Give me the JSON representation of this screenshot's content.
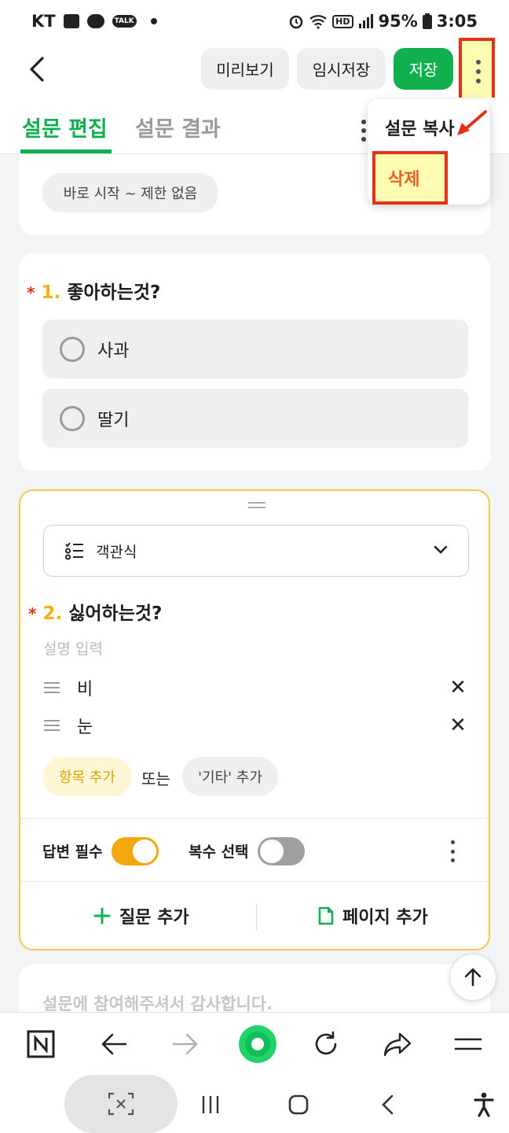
{
  "status_bar": {
    "carrier": "KT",
    "talk_badge": "TALK",
    "hd": "HD",
    "battery": "95%",
    "time": "3:05"
  },
  "header": {
    "preview_label": "미리보기",
    "temp_save_label": "임시저장",
    "save_label": "저장"
  },
  "tabs": [
    {
      "label": "설문 편집",
      "active": true
    },
    {
      "label": "설문 결과",
      "active": false
    }
  ],
  "dropdown": {
    "copy_label": "설문 복사",
    "delete_label": "삭제"
  },
  "top_card": {
    "period_chip": "바로 시작 ~ 제한 없음"
  },
  "question1": {
    "required_mark": "*",
    "number": "1.",
    "title": "좋아하는것?",
    "options": [
      "사과",
      "딸기"
    ]
  },
  "question2": {
    "type_label": "객관식",
    "required_mark": "*",
    "number": "2.",
    "title": "싫어하는것?",
    "description_placeholder": "설명 입력",
    "items": [
      "비",
      "눈"
    ],
    "add_item_label": "항목 추가",
    "or_label": "또는",
    "add_etc_label": "'기타' 추가",
    "required_toggle_label": "답변 필수",
    "required_toggle_on": true,
    "multi_select_label": "복수 선택",
    "multi_select_on": false,
    "add_question_label": "질문 추가",
    "add_page_label": "페이지 추가"
  },
  "thanks_card": {
    "text": "설문에 참여해주셔서 감사합니다."
  },
  "colors": {
    "brand_green": "#10b04f",
    "accent_yellow": "#f2b312",
    "toggle_on": "#f5a70f",
    "highlight_red": "#e3301b",
    "highlight_fill": "#fffbb0"
  }
}
